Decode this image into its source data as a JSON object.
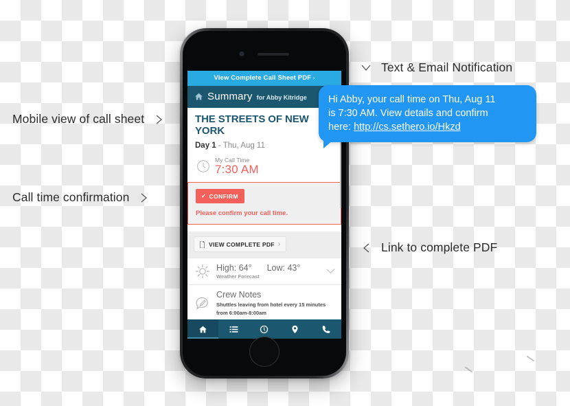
{
  "annotations": [
    {
      "id": "mobile-view",
      "label": "Mobile view of call sheet",
      "chevron": "chevron-right-icon"
    },
    {
      "id": "call-time",
      "label": "Call time confirmation",
      "chevron": "chevron-right-icon"
    },
    {
      "id": "text-email",
      "label": "Text & Email Notification",
      "chevron": "chevron-down-icon"
    },
    {
      "id": "link-pdf",
      "label": "Link to complete PDF",
      "chevron": "chevron-left-icon"
    }
  ],
  "phone": {
    "topbar": {
      "label": "View Complete Call Sheet PDF",
      "arrow": "›",
      "background": "#29abe2"
    },
    "header": {
      "home_icon": "home-icon",
      "title": "Summary",
      "subtitle": "for Abby Kitridge",
      "background": "#1c5770"
    },
    "production": {
      "title": "THE STREETS OF NEW YORK",
      "day_label": "Day 1",
      "day_separator": " - ",
      "day_date": "Thu, Aug 11"
    },
    "call_time": {
      "icon": "clock-icon",
      "label": "My Call Time",
      "value": "7:30 AM",
      "color": "#f4615a"
    },
    "confirm": {
      "button_check": "✓",
      "button_label": "CONFIRM",
      "message": "Please confirm your call time.",
      "color": "#f4615a"
    },
    "pdf": {
      "icon": "document-icon",
      "label": "VIEW COMPLETE PDF",
      "arrow": "›"
    },
    "weather": {
      "icon": "sun-icon",
      "high": "High: 64°",
      "low": "Low: 43°",
      "caption": "Weather Forecast",
      "expand_icon": "chevron-down-icon"
    },
    "crew_notes": {
      "icon": "note-bubble-icon",
      "title": "Crew Notes",
      "line1": "Shuttles leaving from hotel every 15 minutes",
      "line2": "from 6:00am-8:00am"
    },
    "tabbar": [
      {
        "name": "home",
        "icon": "home-icon",
        "active": true
      },
      {
        "name": "schedule",
        "icon": "list-icon",
        "active": false
      },
      {
        "name": "times",
        "icon": "clock-icon",
        "active": false
      },
      {
        "name": "location",
        "icon": "map-pin-icon",
        "active": false
      },
      {
        "name": "contacts",
        "icon": "phone-icon",
        "active": false
      }
    ]
  },
  "sms": {
    "line1": "Hi Abby, your call time on Thu, Aug 11",
    "line2": "is 7:30 AM.  View details and confirm",
    "line3_prefix": "here:  ",
    "link": "http://cs.sethero.io/Hkzd",
    "background": "#2196f3"
  }
}
